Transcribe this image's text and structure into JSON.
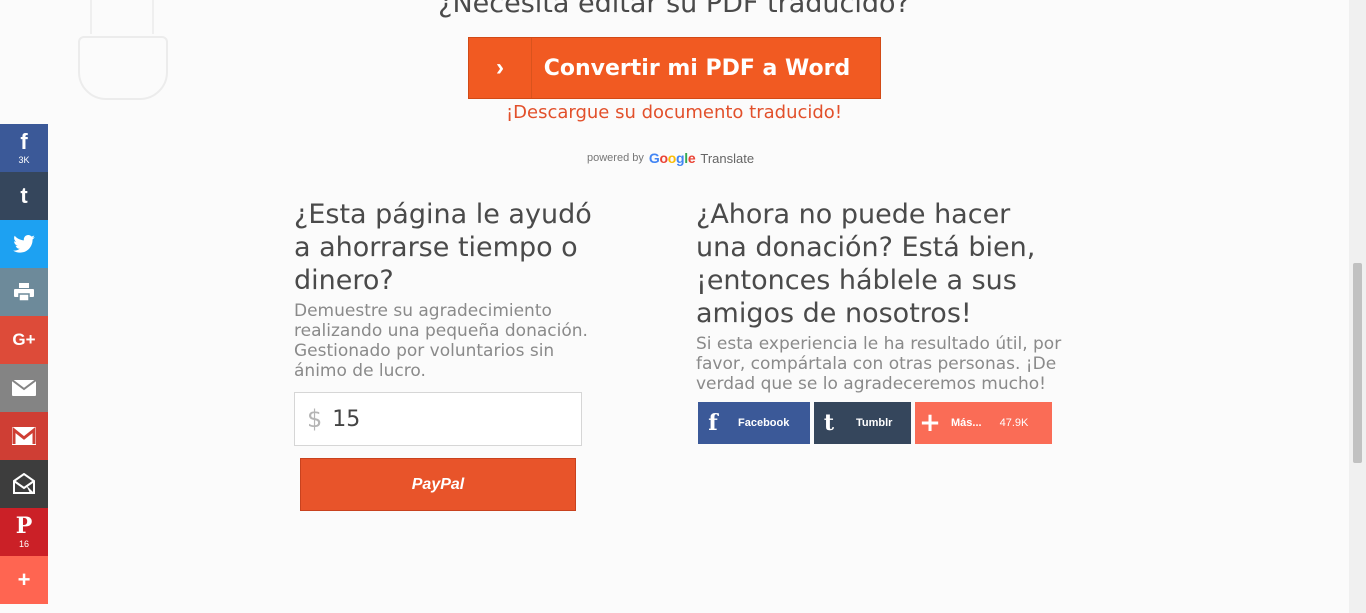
{
  "header": {
    "heading": "¿Necesita editar su PDF traducido?",
    "convert_icon": "›",
    "convert_label": "Convertir mi PDF a Word",
    "download_link": "¡Descargue su documento traducido!"
  },
  "powered": {
    "prefix": "powered by",
    "google": [
      "G",
      "o",
      "o",
      "g",
      "l",
      "e"
    ],
    "google_colors": [
      "#4285f4",
      "#ea4335",
      "#fbbc05",
      "#4285f4",
      "#34a853",
      "#ea4335"
    ],
    "translate": "Translate"
  },
  "donate": {
    "title": "¿Esta página le ayudó a ahorrarse tiempo o dinero?",
    "text": "Demuestre su agradecimiento realizando una pequeña donación. Gestionado por voluntarios sin ánimo de lucro.",
    "currency": "$",
    "amount": "15",
    "paypal_label": "PayPal"
  },
  "share": {
    "title": "¿Ahora no puede hacer una donación? Está bien, ¡entonces háblele a sus amigos de nosotros!",
    "text": "Si esta experiencia le ha resultado útil, por favor, compártala con otras personas. ¡De verdad que se lo agradeceremos mucho!",
    "facebook_label": "Facebook",
    "tumblr_label": "Tumblr",
    "more_label": "Más...",
    "more_count": "47.9K",
    "facebook_icon": "f",
    "tumblr_icon": "t",
    "more_icon": "+"
  },
  "rail": {
    "facebook": {
      "glyph": "f",
      "count": "3K",
      "icon": "facebook-icon"
    },
    "tumblr": {
      "glyph": "t",
      "icon": "tumblr-icon"
    },
    "twitter": {
      "glyph": "🐦",
      "icon": "twitter-icon"
    },
    "print": {
      "glyph": "🖶",
      "icon": "print-icon"
    },
    "googleplus": {
      "glyph": "G+",
      "icon": "google-plus-icon"
    },
    "email": {
      "glyph": "✉",
      "icon": "email-icon"
    },
    "gmail": {
      "glyph": "M",
      "icon": "gmail-icon"
    },
    "mewe": {
      "glyph": "⌂",
      "icon": "mailru-icon"
    },
    "pinterest": {
      "glyph": "P",
      "count": "16",
      "icon": "pinterest-icon"
    },
    "more": {
      "glyph": "+",
      "icon": "plus-icon"
    }
  },
  "colors": {
    "accent": "#f15a22",
    "link": "#e2502b",
    "facebook": "#3b5998",
    "tumblr": "#35465c",
    "more": "#fa6c56"
  }
}
